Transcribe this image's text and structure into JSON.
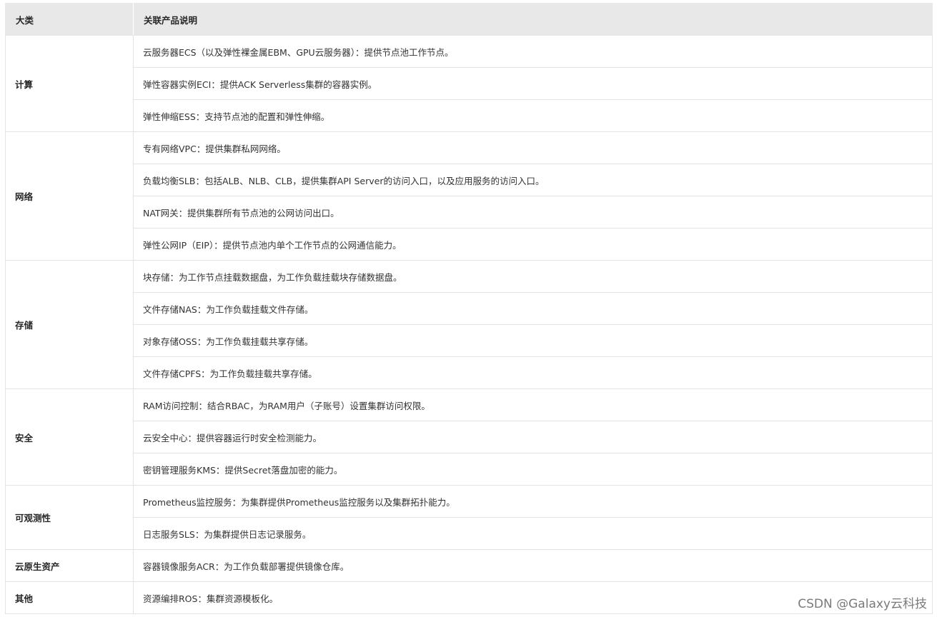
{
  "table": {
    "headers": [
      "大类",
      "关联产品说明"
    ],
    "groups": [
      {
        "category": "计算",
        "items": [
          "云服务器ECS（以及弹性裸金属EBM、GPU云服务器）：提供节点池工作节点。",
          "弹性容器实例ECI：提供ACK Serverless集群的容器实例。",
          "弹性伸缩ESS：支持节点池的配置和弹性伸缩。"
        ]
      },
      {
        "category": "网络",
        "items": [
          "专有网络VPC：提供集群私网网络。",
          "负载均衡SLB：包括ALB、NLB、CLB，提供集群API Server的访问入口，以及应用服务的访问入口。",
          "NAT网关：提供集群所有节点池的公网访问出口。",
          "弹性公网IP（EIP）：提供节点池内单个工作节点的公网通信能力。"
        ]
      },
      {
        "category": "存储",
        "items": [
          "块存储：为工作节点挂载数据盘，为工作负载挂载块存储数据盘。",
          "文件存储NAS：为工作负载挂载文件存储。",
          "对象存储OSS：为工作负载挂载共享存储。",
          "文件存储CPFS：为工作负载挂载共享存储。"
        ]
      },
      {
        "category": "安全",
        "items": [
          "RAM访问控制：结合RBAC，为RAM用户（子账号）设置集群访问权限。",
          "云安全中心：提供容器运行时安全检测能力。",
          "密钥管理服务KMS：提供Secret落盘加密的能力。"
        ]
      },
      {
        "category": "可观测性",
        "items": [
          "Prometheus监控服务：为集群提供Prometheus监控服务以及集群拓扑能力。",
          "日志服务SLS：为集群提供日志记录服务。"
        ]
      },
      {
        "category": "云原生资产",
        "items": [
          "容器镜像服务ACR：为工作负载部署提供镜像仓库。"
        ]
      },
      {
        "category": "其他",
        "items": [
          "资源编排ROS：集群资源模板化。"
        ]
      }
    ]
  },
  "watermark": "CSDN @Galaxy云科技"
}
